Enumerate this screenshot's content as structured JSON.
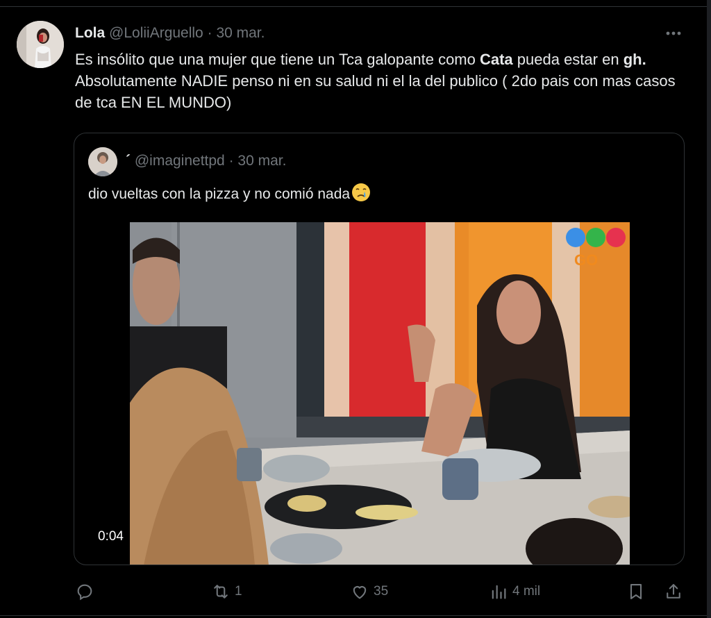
{
  "tweet": {
    "author_name": "Lola",
    "handle": "@LoliiArguello",
    "separator": "·",
    "date": "30 mar.",
    "text_parts": [
      {
        "t": "Es insólito que una mujer que tiene un Tca galopante como "
      },
      {
        "t": "Cata",
        "bold": true
      },
      {
        "t": " pueda estar en "
      },
      {
        "t": "gh.",
        "bold": true
      },
      {
        "t": " Absolutamente NADIE penso ni en su salud ni el la del publico ( 2do pais con mas casos de tca EN EL MUNDO)"
      }
    ]
  },
  "quote": {
    "author_name": "´",
    "handle": "@imaginettpd",
    "separator": "·",
    "date": "30 mar.",
    "text": "dio vueltas con la pizza y no comió nada",
    "emoji": "crying-face",
    "video": {
      "duration": "0:04",
      "channel_logo_text": "GO"
    }
  },
  "actions": {
    "replies": "",
    "retweets": "1",
    "likes": "35",
    "views": "4 mil"
  },
  "colors": {
    "background": "#000000",
    "text": "#e7e9ea",
    "muted": "#71767b",
    "border": "#2f3336"
  },
  "icons": [
    "more-icon",
    "reply-icon",
    "retweet-icon",
    "like-icon",
    "views-icon",
    "bookmark-icon",
    "share-icon"
  ]
}
